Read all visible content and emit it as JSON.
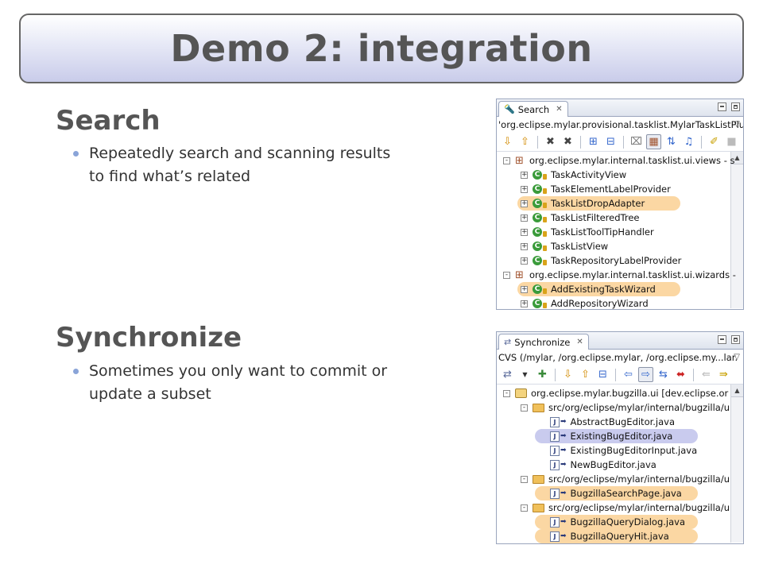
{
  "title": "Demo 2: integration",
  "sections": [
    {
      "heading": "Search",
      "bullet": "Repeatedly search and scanning results to find what’s related"
    },
    {
      "heading": "Synchronize",
      "bullet": "Sometimes you only want to commit or update a subset"
    }
  ],
  "search_view": {
    "tab_label": "Search",
    "description": "'org.eclipse.mylar.provisional.tasklist.MylarTaskListPlu",
    "rows": [
      {
        "label": "org.eclipse.mylar.internal.tasklist.ui.views - s",
        "icon": "package-icon",
        "highlight": "none"
      },
      {
        "label": "TaskActivityView",
        "icon": "class-icon",
        "highlight": "none"
      },
      {
        "label": "TaskElementLabelProvider",
        "icon": "class-icon",
        "highlight": "none"
      },
      {
        "label": "TaskListDropAdapter",
        "icon": "class-icon",
        "highlight": "orange"
      },
      {
        "label": "TaskListFilteredTree",
        "icon": "class-icon",
        "highlight": "none"
      },
      {
        "label": "TaskListToolTipHandler",
        "icon": "class-icon",
        "highlight": "none"
      },
      {
        "label": "TaskListView",
        "icon": "class-icon",
        "highlight": "none"
      },
      {
        "label": "TaskRepositoryLabelProvider",
        "icon": "class-icon",
        "highlight": "none"
      },
      {
        "label": "org.eclipse.mylar.internal.tasklist.ui.wizards -",
        "icon": "package-icon",
        "highlight": "none"
      },
      {
        "label": "AddExistingTaskWizard",
        "icon": "class-icon",
        "highlight": "orange"
      },
      {
        "label": "AddRepositoryWizard",
        "icon": "class-icon",
        "highlight": "none"
      }
    ]
  },
  "sync_view": {
    "tab_label": "Synchronize",
    "description": "CVS (/mylar, /org.eclipse.mylar, /org.eclipse.my...lar.",
    "rows": [
      {
        "label": "org.eclipse.mylar.bugzilla.ui    [dev.eclipse.or",
        "icon": "project-icon",
        "highlight": "none"
      },
      {
        "label": "src/org/eclipse/mylar/internal/bugzilla/u",
        "icon": "folder-icon",
        "highlight": "none"
      },
      {
        "label": "AbstractBugEditor.java",
        "icon": "java-file-icon",
        "highlight": "none"
      },
      {
        "label": "ExistingBugEditor.java",
        "icon": "java-file-icon",
        "highlight": "blue"
      },
      {
        "label": "ExistingBugEditorInput.java",
        "icon": "java-file-icon",
        "highlight": "none"
      },
      {
        "label": "NewBugEditor.java",
        "icon": "java-file-icon",
        "highlight": "none"
      },
      {
        "label": "src/org/eclipse/mylar/internal/bugzilla/u",
        "icon": "folder-icon",
        "highlight": "none"
      },
      {
        "label": "BugzillaSearchPage.java",
        "icon": "java-file-icon",
        "highlight": "orange"
      },
      {
        "label": "src/org/eclipse/mylar/internal/bugzilla/u",
        "icon": "folder-icon",
        "highlight": "none"
      },
      {
        "label": "BugzillaQueryDialog.java",
        "icon": "java-file-icon",
        "highlight": "orange"
      },
      {
        "label": "BugzillaQueryHit.java",
        "icon": "java-file-icon",
        "highlight": "orange"
      }
    ]
  },
  "colors": {
    "highlight_orange": "#fbd7a3",
    "highlight_blue": "#c9cbee",
    "bullet_dot": "#8aa4d8"
  }
}
